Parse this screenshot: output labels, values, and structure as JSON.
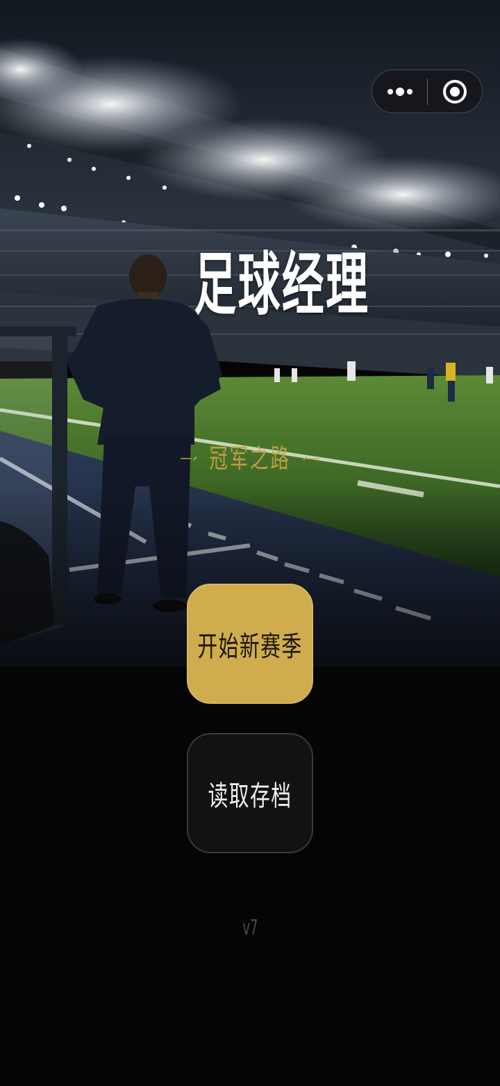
{
  "app": {
    "title": "足球经理",
    "subtitle": "冠军之路",
    "version": "v7"
  },
  "capsule": {
    "more_icon": "more-dots-icon",
    "close_icon": "target-close-icon"
  },
  "buttons": {
    "new_season": "开始新赛季",
    "load_save": "读取存档"
  },
  "colors": {
    "accent_gold": "#cfad4f",
    "dark_button": "#121212",
    "title_white": "#ffffff"
  }
}
